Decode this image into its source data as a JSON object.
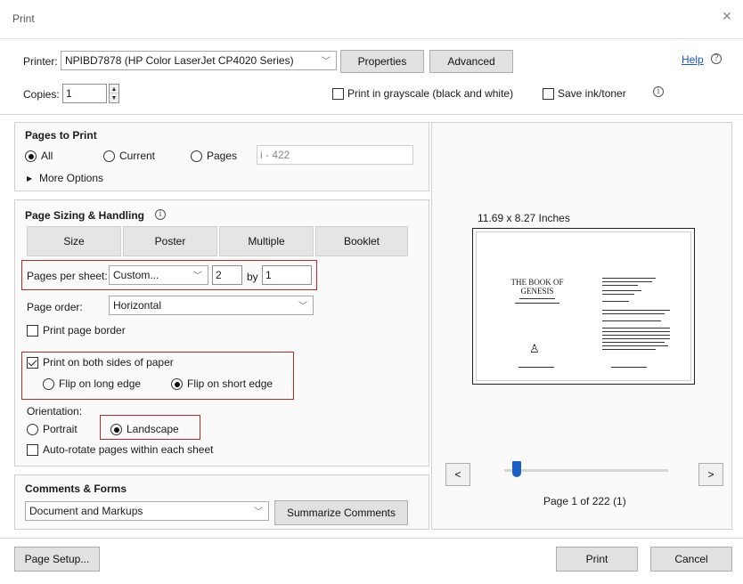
{
  "window": {
    "title": "Print"
  },
  "header": {
    "printer_label": "Printer:",
    "printer_value": "NPIBD7878 (HP Color LaserJet CP4020 Series)",
    "properties_label": "Properties",
    "advanced_label": "Advanced",
    "help_label": "Help",
    "copies_label": "Copies:",
    "copies_value": "1",
    "grayscale_label": "Print in grayscale (black and white)",
    "grayscale_checked": false,
    "save_ink_label": "Save ink/toner",
    "save_ink_checked": false
  },
  "pages_to_print": {
    "title": "Pages to Print",
    "all_label": "All",
    "current_label": "Current",
    "pages_label": "Pages",
    "pages_range": "i - 422",
    "selected": "All",
    "more_options_label": "More Options"
  },
  "sizing": {
    "title": "Page Sizing & Handling",
    "tabs": [
      {
        "label": "Size"
      },
      {
        "label": "Poster"
      },
      {
        "label": "Multiple"
      },
      {
        "label": "Booklet"
      }
    ],
    "pages_per_sheet_label": "Pages per sheet:",
    "pages_per_sheet_value": "Custom...",
    "cols_value": "2",
    "by_label": "by",
    "rows_value": "1",
    "page_order_label": "Page order:",
    "page_order_value": "Horizontal",
    "print_border_label": "Print page border",
    "both_sides_label": "Print on both sides of paper",
    "both_sides_checked": true,
    "flip_long_label": "Flip on long edge",
    "flip_short_label": "Flip on short edge",
    "flip_selected": "short",
    "orientation_label": "Orientation:",
    "portrait_label": "Portrait",
    "landscape_label": "Landscape",
    "orientation_selected": "Landscape",
    "auto_rotate_label": "Auto-rotate pages within each sheet"
  },
  "comments": {
    "title": "Comments & Forms",
    "value": "Document and Markups",
    "summarize_label": "Summarize Comments"
  },
  "preview": {
    "paper_size": "11.69 x 8.27 Inches",
    "book_title_line1": "THE BOOK OF",
    "book_title_line2": "GENESIS",
    "page_info": "Page 1 of 222 (1)",
    "prev_label": "<",
    "next_label": ">",
    "slider_position": 0.05
  },
  "footer": {
    "page_setup_label": "Page Setup...",
    "print_label": "Print",
    "cancel_label": "Cancel"
  },
  "icons": {
    "close": "close-icon",
    "help": "help-circle-icon",
    "info": "info-icon",
    "chevron": "chevron-down-icon",
    "triangle": "triangle-right-icon"
  }
}
